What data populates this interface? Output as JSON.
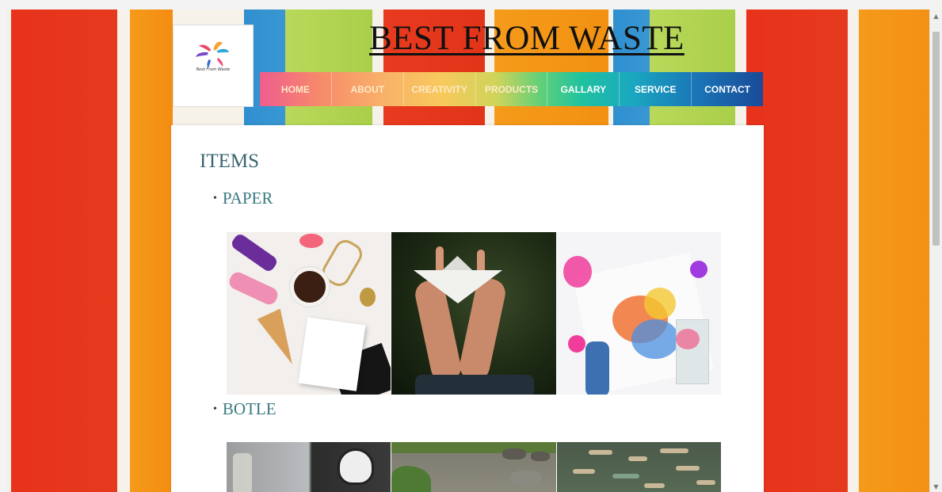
{
  "site": {
    "title": "BEST FROM WASTE",
    "logo_text": "Best From Waste"
  },
  "nav": {
    "items": [
      "HOME",
      "ABOUT",
      "CREATIVITY",
      "PRODUCTS",
      "GALLARY",
      "SERVICE",
      "CONTACT"
    ]
  },
  "content": {
    "heading": "ITEMS",
    "categories": [
      {
        "label": "PAPER",
        "images": [
          "craft-flatlay-photo",
          "paper-boat-photo",
          "paint-splatter-photo"
        ]
      },
      {
        "label": "BOTLE",
        "images": [
          "bottle-crafts-photo",
          "bottle-litter-ground-photo",
          "bottle-litter-water-photo"
        ]
      }
    ]
  },
  "colors": {
    "nav_start": "#ef5d8e",
    "nav_end": "#1a4a98",
    "heading": "#3a6670",
    "category": "#3a7a80"
  },
  "icons": [
    "logo-petal-icon",
    "scroll-up-icon",
    "scroll-down-icon"
  ]
}
